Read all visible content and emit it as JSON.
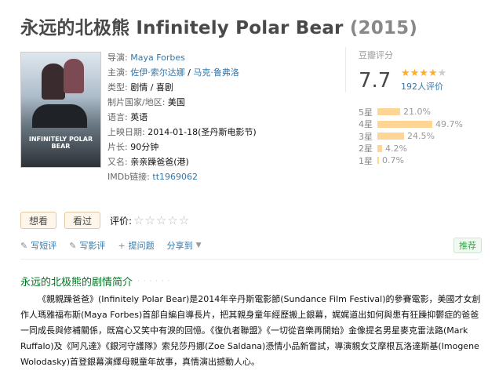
{
  "title": {
    "cn": "永远的北极熊",
    "en": "Infinitely Polar Bear",
    "year": "(2015)"
  },
  "poster": {
    "text": "INFINITELY POLAR BEAR"
  },
  "info": {
    "director_label": "导演:",
    "director": "Maya Forbes",
    "cast_label": "主演:",
    "cast1": "佐伊·索尔达娜",
    "cast_sep": " / ",
    "cast2": "马克·鲁弗洛",
    "genre_label": "类型:",
    "genre": "剧情 / 喜剧",
    "country_label": "制片国家/地区:",
    "country": "美国",
    "language_label": "语言:",
    "language": "英语",
    "release_label": "上映日期:",
    "release": "2014-01-18(圣丹斯电影节)",
    "runtime_label": "片长:",
    "runtime": "90分钟",
    "aka_label": "又名:",
    "aka": "亲亲躁爸爸(港)",
    "imdb_label": "IMDb链接:",
    "imdb": "tt1969062"
  },
  "rating": {
    "header": "豆瓣评分",
    "score": "7.7",
    "stars_filled": "★★★★",
    "stars_empty": "★",
    "count": "192人评价",
    "distribution": [
      {
        "label": "5星",
        "percent": "21.0%",
        "value": 21.0
      },
      {
        "label": "4星",
        "percent": "49.7%",
        "value": 49.7
      },
      {
        "label": "3星",
        "percent": "24.5%",
        "value": 24.5
      },
      {
        "label": "2星",
        "percent": "4.2%",
        "value": 4.2
      },
      {
        "label": "1星",
        "percent": "0.7%",
        "value": 0.7
      }
    ]
  },
  "buttons": {
    "want": "想看",
    "seen": "看过",
    "rate_label": "评价:",
    "empty_stars": "☆☆☆☆☆"
  },
  "actions": {
    "short_review": "写短评",
    "review": "写影评",
    "question": "提问题",
    "share": "分享到",
    "recommend": "推荐"
  },
  "colors": {
    "link": "#3377aa",
    "green": "#007722",
    "star": "#ffac2d",
    "bar": "#ffd596"
  },
  "synopsis": {
    "title": "永远的北极熊的剧情简介",
    "dots": "· · · · · ·",
    "text": "《親親躁爸爸》(Infinitely Polar Bear)是2014年辛丹斯電影節(Sundance Film Festival)的參賽電影，美國才女創作人瑪雅福布斯(Maya Forbes)首部自編自導長片，把其親身童年經歷搬上銀幕，娓娓道出如何與患有狂躁抑鬱症的爸爸一同成長與修補關係，既窩心又笑中有淚的回憶。《復仇者聯盟》《一切從音樂再開始》金像提名男星麥克雷法路(Mark Ruffalo)及《阿凡達》《銀河守護隊》索兒莎丹娜(Zoe Saldana)憑情小品新嘗試，導演親女艾摩根瓦洛達斯基(Imogene Wolodasky)首登銀幕演繹母親童年故事，真情演出撼動人心。"
  }
}
